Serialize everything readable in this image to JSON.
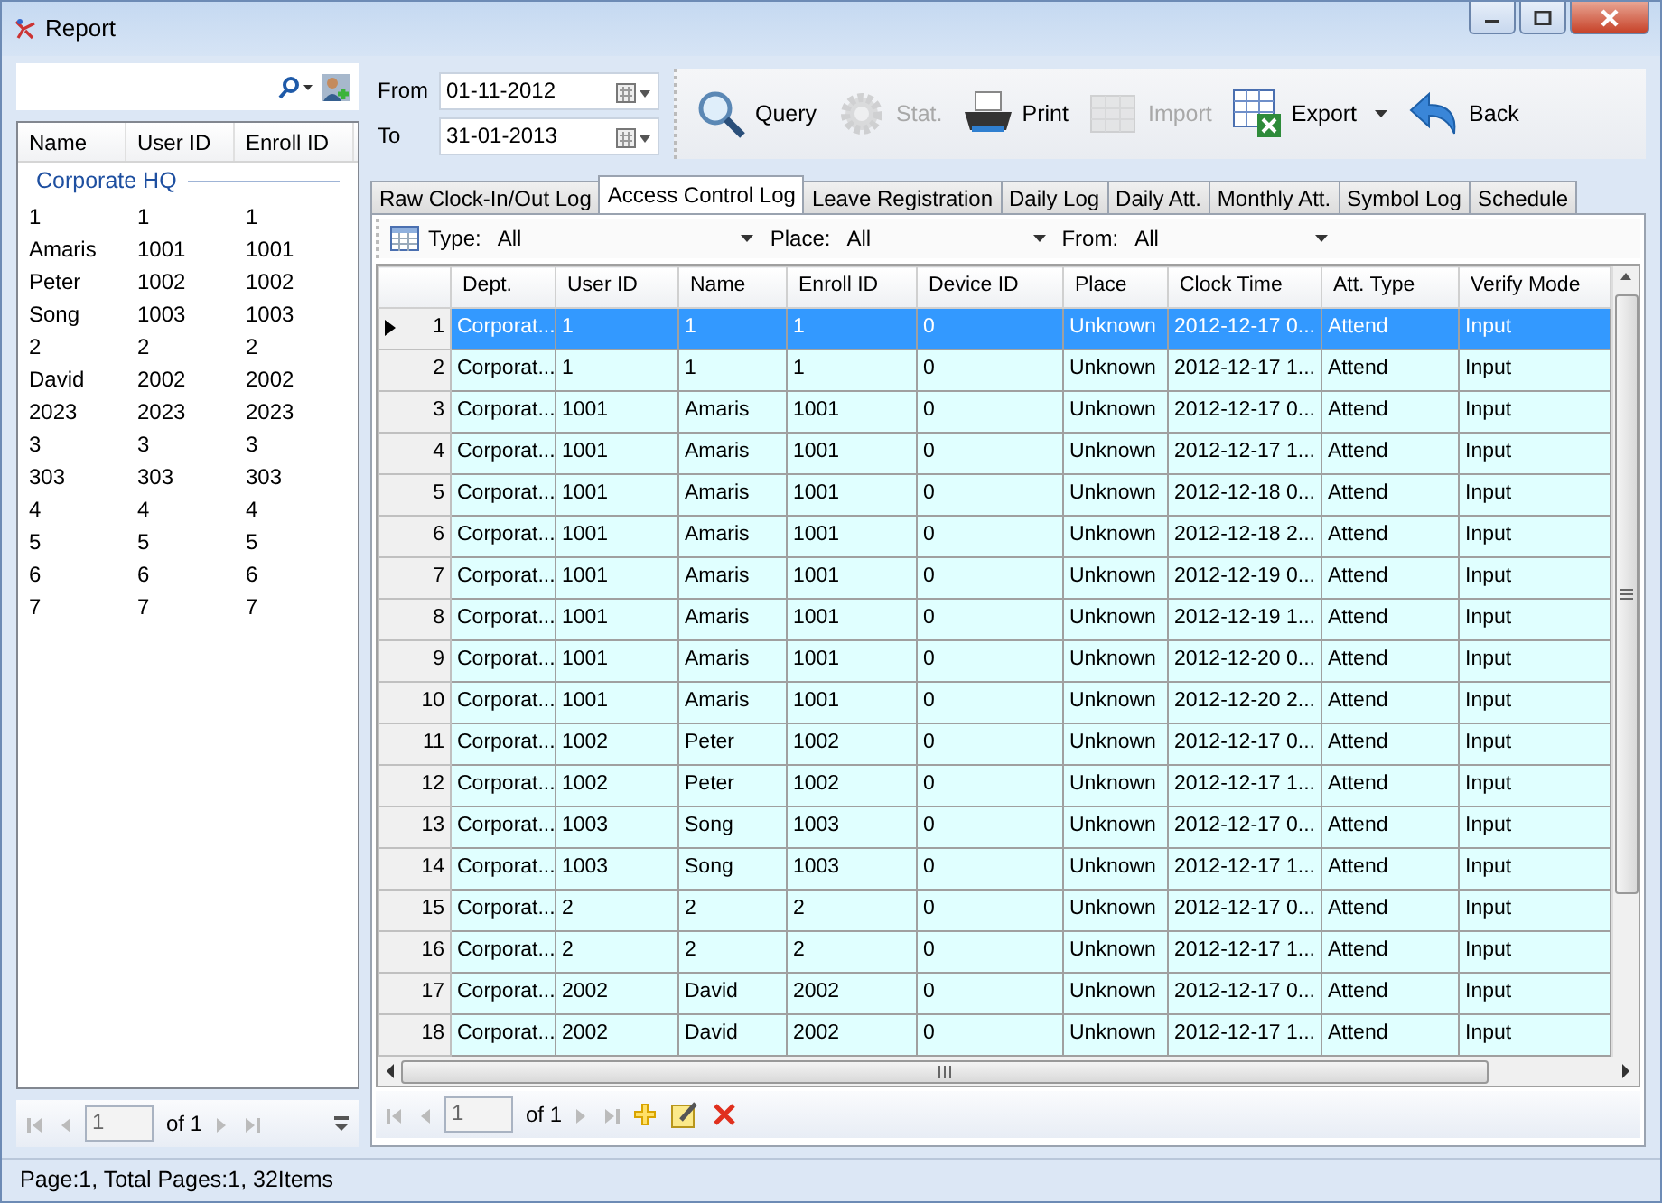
{
  "window": {
    "title": "Report"
  },
  "user_list": {
    "columns": [
      "Name",
      "User ID",
      "Enroll ID"
    ],
    "group": "Corporate HQ",
    "rows": [
      [
        "1",
        "1",
        "1"
      ],
      [
        "Amaris",
        "1001",
        "1001"
      ],
      [
        "Peter",
        "1002",
        "1002"
      ],
      [
        "Song",
        "1003",
        "1003"
      ],
      [
        "2",
        "2",
        "2"
      ],
      [
        "David",
        "2002",
        "2002"
      ],
      [
        "2023",
        "2023",
        "2023"
      ],
      [
        "3",
        "3",
        "3"
      ],
      [
        "303",
        "303",
        "303"
      ],
      [
        "4",
        "4",
        "4"
      ],
      [
        "5",
        "5",
        "5"
      ],
      [
        "6",
        "6",
        "6"
      ],
      [
        "7",
        "7",
        "7"
      ]
    ]
  },
  "left_pager": {
    "page": "1",
    "of": "of 1"
  },
  "date_range": {
    "from_label": "From",
    "from": "01-11-2012",
    "to_label": "To",
    "to": "31-01-2013"
  },
  "toolbar": [
    {
      "kind": "query",
      "label": "Query",
      "disabled": false,
      "dropdown": false
    },
    {
      "kind": "stat",
      "label": "Stat.",
      "disabled": true,
      "dropdown": false
    },
    {
      "kind": "print",
      "label": "Print",
      "disabled": false,
      "dropdown": false
    },
    {
      "kind": "import",
      "label": "Import",
      "disabled": true,
      "dropdown": false
    },
    {
      "kind": "export",
      "label": "Export",
      "disabled": false,
      "dropdown": true
    },
    {
      "kind": "back",
      "label": "Back",
      "disabled": false,
      "dropdown": false
    }
  ],
  "tabs": [
    {
      "label": "Raw Clock-In/Out Log",
      "selected": false
    },
    {
      "label": "Access Control Log",
      "selected": true
    },
    {
      "label": "Leave Registration",
      "selected": false
    },
    {
      "label": "Daily Log",
      "selected": false
    },
    {
      "label": "Daily Att.",
      "selected": false
    },
    {
      "label": "Monthly Att.",
      "selected": false
    },
    {
      "label": "Symbol Log",
      "selected": false
    },
    {
      "label": "Schedule",
      "selected": false
    }
  ],
  "filters": [
    {
      "label": "Type:",
      "value": "All"
    },
    {
      "label": "Place:",
      "value": "All"
    },
    {
      "label": "From:",
      "value": "All"
    }
  ],
  "table": {
    "columns": [
      "Dept.",
      "User ID",
      "Name",
      "Enroll ID",
      "Device ID",
      "Place",
      "Clock Time",
      "Att. Type",
      "Verify Mode"
    ],
    "rows": [
      {
        "number": "1",
        "selected": true,
        "cells": [
          "Corporat...",
          "1",
          "1",
          "1",
          "0",
          "Unknown",
          "2012-12-17 0...",
          "Attend",
          "Input"
        ]
      },
      {
        "number": "2",
        "selected": false,
        "cells": [
          "Corporat...",
          "1",
          "1",
          "1",
          "0",
          "Unknown",
          "2012-12-17 1...",
          "Attend",
          "Input"
        ]
      },
      {
        "number": "3",
        "selected": false,
        "cells": [
          "Corporat...",
          "1001",
          "Amaris",
          "1001",
          "0",
          "Unknown",
          "2012-12-17 0...",
          "Attend",
          "Input"
        ]
      },
      {
        "number": "4",
        "selected": false,
        "cells": [
          "Corporat...",
          "1001",
          "Amaris",
          "1001",
          "0",
          "Unknown",
          "2012-12-17 1...",
          "Attend",
          "Input"
        ]
      },
      {
        "number": "5",
        "selected": false,
        "cells": [
          "Corporat...",
          "1001",
          "Amaris",
          "1001",
          "0",
          "Unknown",
          "2012-12-18 0...",
          "Attend",
          "Input"
        ]
      },
      {
        "number": "6",
        "selected": false,
        "cells": [
          "Corporat...",
          "1001",
          "Amaris",
          "1001",
          "0",
          "Unknown",
          "2012-12-18 2...",
          "Attend",
          "Input"
        ]
      },
      {
        "number": "7",
        "selected": false,
        "cells": [
          "Corporat...",
          "1001",
          "Amaris",
          "1001",
          "0",
          "Unknown",
          "2012-12-19 0...",
          "Attend",
          "Input"
        ]
      },
      {
        "number": "8",
        "selected": false,
        "cells": [
          "Corporat...",
          "1001",
          "Amaris",
          "1001",
          "0",
          "Unknown",
          "2012-12-19 1...",
          "Attend",
          "Input"
        ]
      },
      {
        "number": "9",
        "selected": false,
        "cells": [
          "Corporat...",
          "1001",
          "Amaris",
          "1001",
          "0",
          "Unknown",
          "2012-12-20 0...",
          "Attend",
          "Input"
        ]
      },
      {
        "number": "10",
        "selected": false,
        "cells": [
          "Corporat...",
          "1001",
          "Amaris",
          "1001",
          "0",
          "Unknown",
          "2012-12-20 2...",
          "Attend",
          "Input"
        ]
      },
      {
        "number": "11",
        "selected": false,
        "cells": [
          "Corporat...",
          "1002",
          "Peter",
          "1002",
          "0",
          "Unknown",
          "2012-12-17 0...",
          "Attend",
          "Input"
        ]
      },
      {
        "number": "12",
        "selected": false,
        "cells": [
          "Corporat...",
          "1002",
          "Peter",
          "1002",
          "0",
          "Unknown",
          "2012-12-17 1...",
          "Attend",
          "Input"
        ]
      },
      {
        "number": "13",
        "selected": false,
        "cells": [
          "Corporat...",
          "1003",
          "Song",
          "1003",
          "0",
          "Unknown",
          "2012-12-17 0...",
          "Attend",
          "Input"
        ]
      },
      {
        "number": "14",
        "selected": false,
        "cells": [
          "Corporat...",
          "1003",
          "Song",
          "1003",
          "0",
          "Unknown",
          "2012-12-17 1...",
          "Attend",
          "Input"
        ]
      },
      {
        "number": "15",
        "selected": false,
        "cells": [
          "Corporat...",
          "2",
          "2",
          "2",
          "0",
          "Unknown",
          "2012-12-17 0...",
          "Attend",
          "Input"
        ]
      },
      {
        "number": "16",
        "selected": false,
        "cells": [
          "Corporat...",
          "2",
          "2",
          "2",
          "0",
          "Unknown",
          "2012-12-17 1...",
          "Attend",
          "Input"
        ]
      },
      {
        "number": "17",
        "selected": false,
        "cells": [
          "Corporat...",
          "2002",
          "David",
          "2002",
          "0",
          "Unknown",
          "2012-12-17 0...",
          "Attend",
          "Input"
        ]
      },
      {
        "number": "18",
        "selected": false,
        "cells": [
          "Corporat...",
          "2002",
          "David",
          "2002",
          "0",
          "Unknown",
          "2012-12-17 1...",
          "Attend",
          "Input"
        ]
      }
    ]
  },
  "pager": {
    "page": "1",
    "of": "of 1"
  },
  "status_bar": "Page:1, Total Pages:1, 32Items"
}
